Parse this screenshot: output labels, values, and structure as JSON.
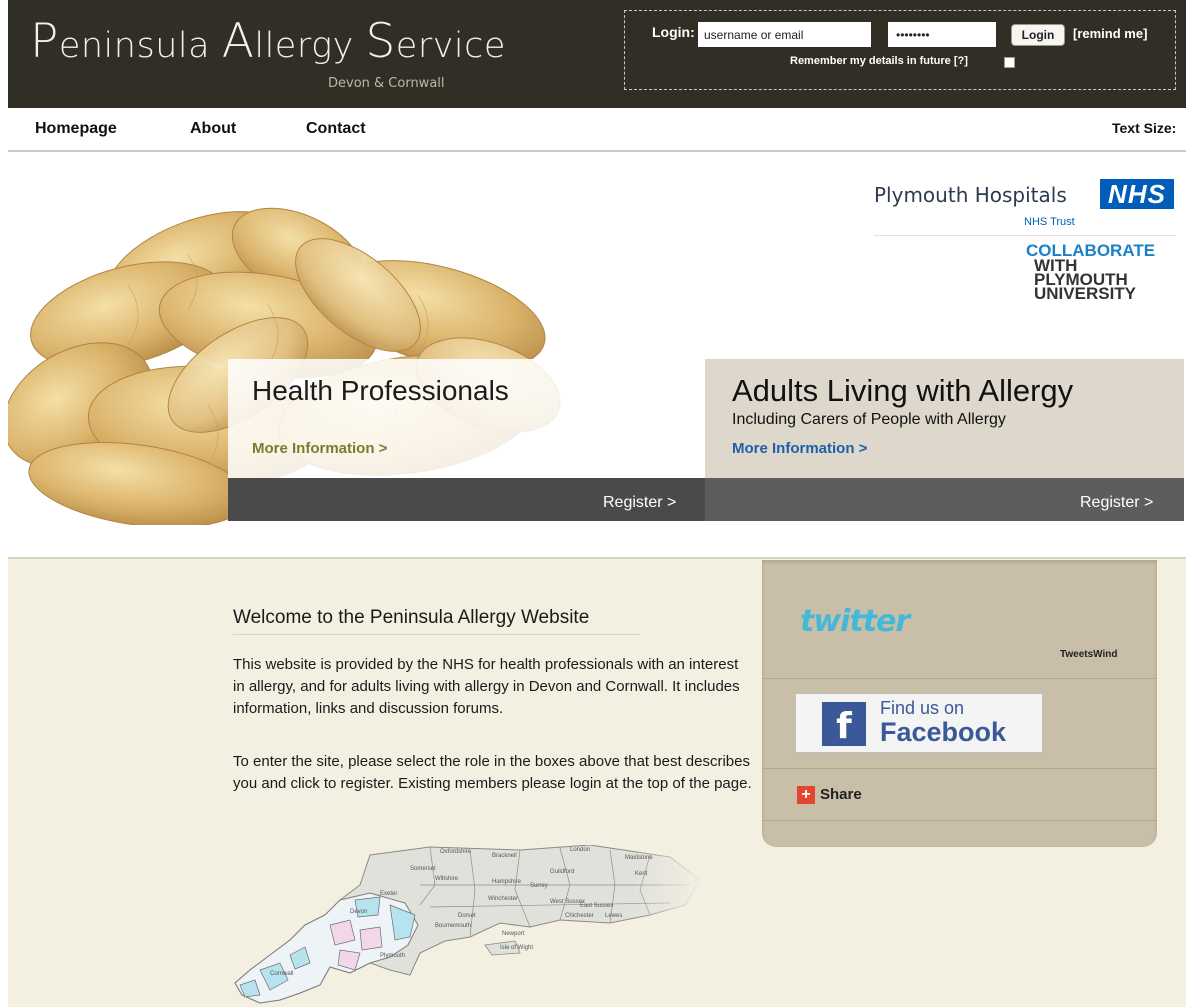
{
  "header": {
    "title_initials": [
      "P",
      "A",
      "S"
    ],
    "title_rest": [
      "eninsula ",
      "llergy ",
      "ervice"
    ],
    "subtitle": "Devon & Cornwall",
    "login": {
      "label": "Login:",
      "username_value": "username or email",
      "password_value": "••••••••",
      "button_label": "Login",
      "remind_label": "[remind me]",
      "remember_text": "Remember my details in future [?]"
    }
  },
  "nav": {
    "items": [
      {
        "label": "Homepage"
      },
      {
        "label": "About"
      },
      {
        "label": "Contact"
      }
    ],
    "text_size_label": "Text Size:"
  },
  "partners": {
    "plymouth_hospitals": "Plymouth Hospitals",
    "nhs": "NHS",
    "nhs_trust": "NHS Trust",
    "collaborate": "COLLABORATE",
    "with_plymouth_university": [
      "WITH",
      "PLYMOUTH",
      "UNIVERSITY"
    ]
  },
  "cards": {
    "health": {
      "title": "Health Professionals",
      "more": "More Information >",
      "register": "Register >"
    },
    "adults": {
      "title": "Adults Living with Allergy",
      "subtitle": "Including Carers of People with Allergy",
      "more": "More Information >",
      "register": "Register >"
    }
  },
  "welcome": {
    "title": "Welcome to the Peninsula Allergy Website",
    "p1": "This website is provided by the NHS for health professionals with an interest in allergy, and for adults living with allergy in Devon and Cornwall. It includes information, links and discussion forums.",
    "p2": "To enter the site, please select the role in the boxes above that best describes you and click to register. Existing members please login at the top of the page."
  },
  "map_labels": [
    "Oxfordshire",
    "Bracknell",
    "London",
    "Somerset",
    "Wiltshire",
    "Hampshire",
    "Surrey",
    "Kent",
    "Guildford",
    "Maidstone",
    "Winchester",
    "West Sussex",
    "East Sussex",
    "Dorset",
    "Chichester",
    "Lewes",
    "Bournemouth",
    "Newport",
    "Isle of Wight",
    "Exeter",
    "Devon",
    "Cornwall",
    "Plymouth"
  ],
  "social": {
    "twitter": "twitter",
    "tweetswind": "TweetsWind",
    "fb_find": "Find us on",
    "fb_name": "Facebook",
    "fb_letter": "f",
    "share": "Share",
    "share_icon": "+"
  },
  "colors": {
    "header_bg": "#312f25",
    "nhs_blue": "#005eb8",
    "facebook_blue": "#3b5998",
    "twitter_blue": "#44b8d8",
    "health_link": "#7c7a2c",
    "adults_link": "#1d5fa8",
    "lower_bg": "#f3f0e2",
    "sidebar_bg": "#c9bfa8"
  }
}
